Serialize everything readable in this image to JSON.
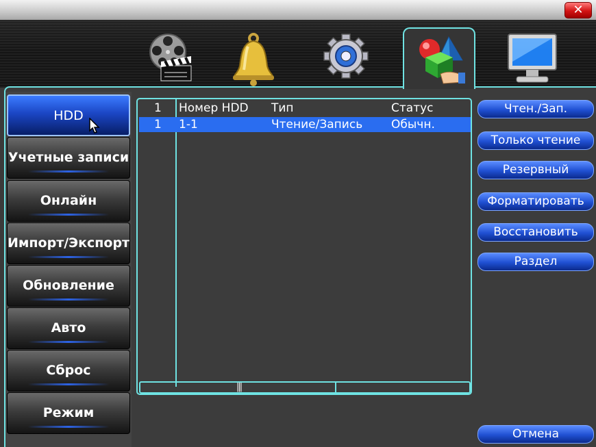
{
  "window": {
    "close_glyph": "✕"
  },
  "toolbar": {
    "icons": [
      "record-film-icon",
      "alarm-bell-icon",
      "system-gear-icon",
      "advanced-tools-icon",
      "info-monitor-icon"
    ],
    "active_index": 3
  },
  "menu": {
    "items": [
      {
        "label": "HDD",
        "active": true
      },
      {
        "label": "Учетные записи",
        "active": false
      },
      {
        "label": "Онлайн",
        "active": false
      },
      {
        "label": "Импорт/Экспорт",
        "active": false
      },
      {
        "label": "Обновление",
        "active": false
      },
      {
        "label": "Авто",
        "active": false
      },
      {
        "label": "Сброс",
        "active": false
      },
      {
        "label": "Режим",
        "active": false
      }
    ]
  },
  "table": {
    "columns": {
      "index": "1",
      "hdd_no": "Номер HDD",
      "type": "Тип",
      "status": "Статус"
    },
    "rows": [
      {
        "index": "1",
        "hdd_no": "1-1",
        "type": "Чтение/Запись",
        "status": "Обычн."
      }
    ],
    "scroll_grip": "|||"
  },
  "buttons": {
    "read_write": "Чтен./Зап.",
    "read_only": "Только чтение",
    "redundant": "Резервный",
    "format": "Форматировать",
    "recover": "Восстановить",
    "partition": "Раздел",
    "cancel": "Отмена"
  },
  "colors": {
    "accent": "#6fe3e3",
    "selection": "#2a6df0",
    "button": "#1f4fd1",
    "close": "#d31414"
  }
}
